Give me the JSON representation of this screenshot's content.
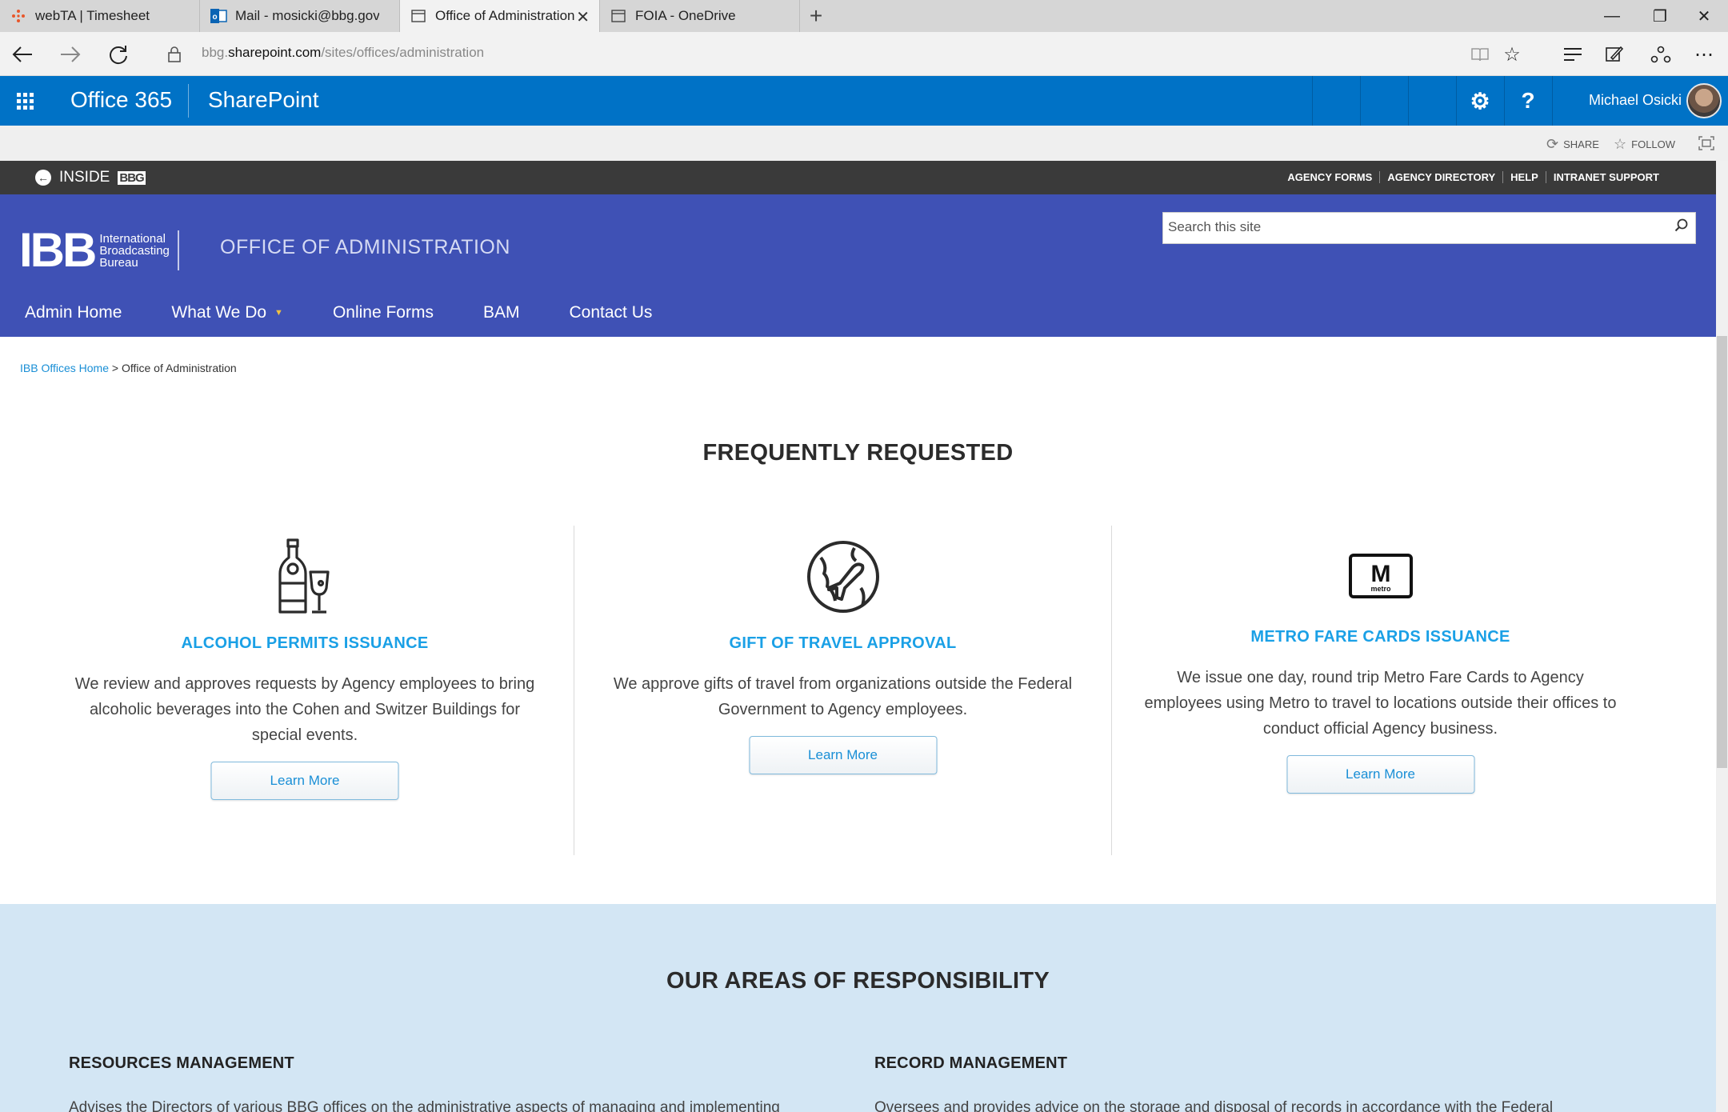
{
  "browser": {
    "tabs": [
      {
        "label": "webTA | Timesheet"
      },
      {
        "label": "Mail - mosicki@bbg.gov"
      },
      {
        "label": "Office of Administration"
      },
      {
        "label": "FOIA - OneDrive"
      }
    ],
    "new_tab": "+",
    "url_prefix": "bbg.",
    "url_domain": "sharepoint.com",
    "url_path": "/sites/offices/administration"
  },
  "suite": {
    "app_name": "Office 365",
    "product": "SharePoint",
    "settings": "⚙",
    "help": "?",
    "user_name": "Michael Osicki"
  },
  "actions": {
    "share": "SHARE",
    "follow": "FOLLOW"
  },
  "inside": {
    "logo_text": "INSIDE",
    "logo_mark": "BBG",
    "links": [
      "AGENCY FORMS",
      "AGENCY DIRECTORY",
      "HELP",
      "INTRANET SUPPORT"
    ]
  },
  "site": {
    "logo_mark": "IBB",
    "logo_line1": "International",
    "logo_line2": "Broadcasting",
    "logo_line3": "Bureau",
    "title": "OFFICE OF ADMINISTRATION",
    "search_placeholder": "Search this site",
    "nav": [
      "Admin Home",
      "What We Do",
      "Online Forms",
      "BAM",
      "Contact Us"
    ]
  },
  "breadcrumb": {
    "home": "IBB Offices Home",
    "separator": " > ",
    "current": "Office of Administration"
  },
  "frequent": {
    "title": "FREQUENTLY REQUESTED",
    "cards": [
      {
        "icon": "champagne-icon",
        "title": "ALCOHOL PERMITS ISSUANCE",
        "desc": "We review and approves requests by Agency employees to bring alcoholic beverages into the Cohen and Switzer Buildings for special events.",
        "button": "Learn More"
      },
      {
        "icon": "globe-plane-icon",
        "title": "GIFT OF TRAVEL APPROVAL",
        "desc": "We approve gifts of travel from organizations outside the Federal Government to Agency employees.",
        "button": "Learn More"
      },
      {
        "icon": "metro-icon",
        "icon_letter": "M",
        "icon_sub": "metro",
        "title": "METRO FARE CARDS ISSUANCE",
        "desc": "We issue one day, round trip Metro Fare Cards to Agency employees using Metro to travel to locations outside their offices to conduct official Agency business.",
        "button": "Learn More"
      }
    ]
  },
  "areas": {
    "title": "OUR AREAS OF RESPONSIBILITY",
    "items": [
      {
        "heading": "RESOURCES MANAGEMENT",
        "text": "Advises the Directors of various BBG offices on the administrative aspects of managing and implementing"
      },
      {
        "heading": "RECORD MANAGEMENT",
        "text": "Oversees and provides advice on the storage and disposal of records in accordance with the Federal"
      }
    ]
  },
  "colors": {
    "suite_blue": "#0072c6",
    "header_indigo": "#3f51b5",
    "accent_cyan": "#1aa0e6",
    "areas_bg": "#d3e6f4"
  }
}
